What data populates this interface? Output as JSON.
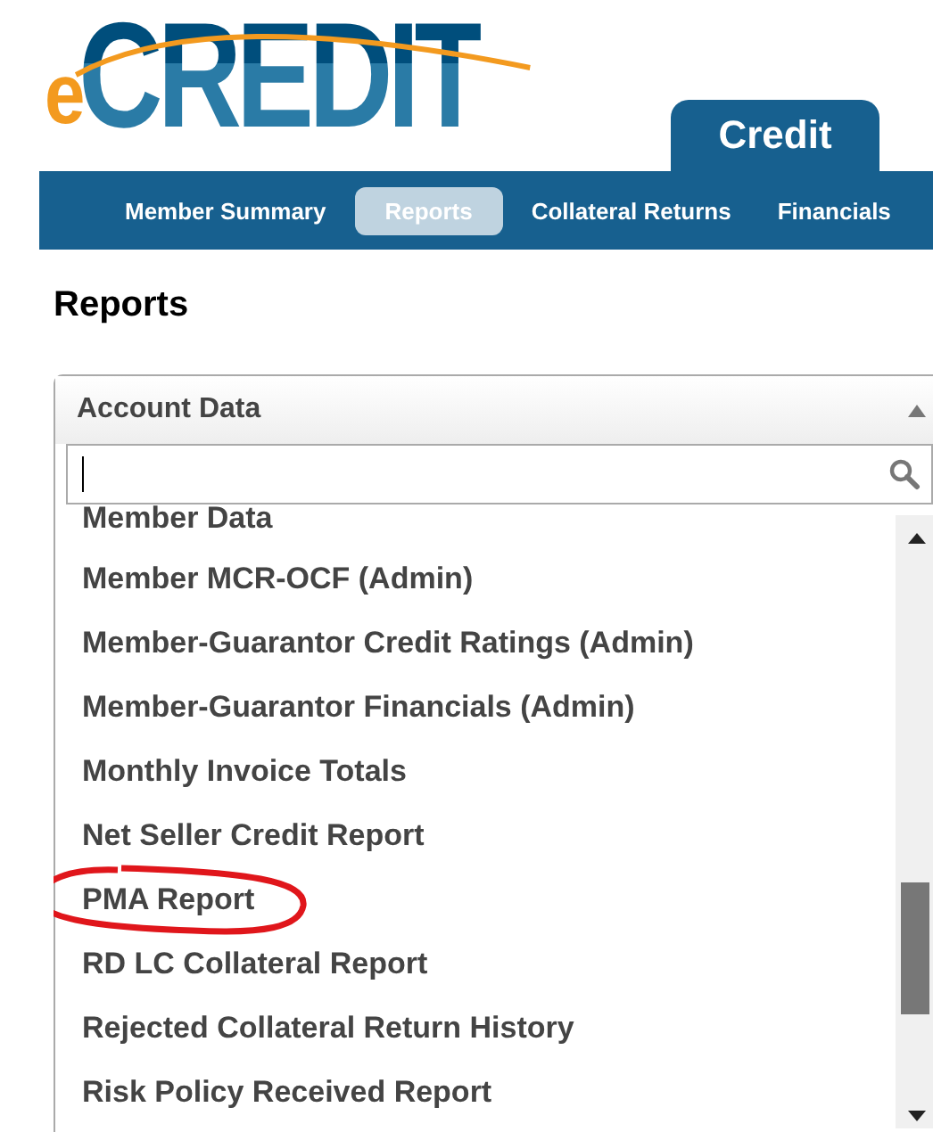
{
  "logo": {
    "prefix": "e",
    "name": "CREDIT"
  },
  "app_tab": {
    "label": "Credit",
    "selected": true
  },
  "nav": [
    {
      "label": "Member Summary",
      "selected": false
    },
    {
      "label": "Reports",
      "selected": true
    },
    {
      "label": "Collateral Returns",
      "selected": false
    },
    {
      "label": "Financials",
      "selected": false
    }
  ],
  "page_title": "Reports",
  "dropdown": {
    "value": "Account Data",
    "expanded": true,
    "items": [
      {
        "label": "Member Data",
        "circled": false
      },
      {
        "label": "Member MCR-OCF (Admin)",
        "circled": false
      },
      {
        "label": "Member-Guarantor Credit Ratings (Admin)",
        "circled": false
      },
      {
        "label": "Member-Guarantor Financials (Admin)",
        "circled": false
      },
      {
        "label": "Monthly Invoice Totals",
        "circled": false
      },
      {
        "label": "Net Seller Credit Report",
        "circled": false
      },
      {
        "label": "PMA Report",
        "circled": true
      },
      {
        "label": "RD LC Collateral Report",
        "circled": false
      },
      {
        "label": "Rejected Collateral Return History",
        "circled": false
      },
      {
        "label": "Risk Policy Received Report",
        "circled": false
      }
    ]
  }
}
